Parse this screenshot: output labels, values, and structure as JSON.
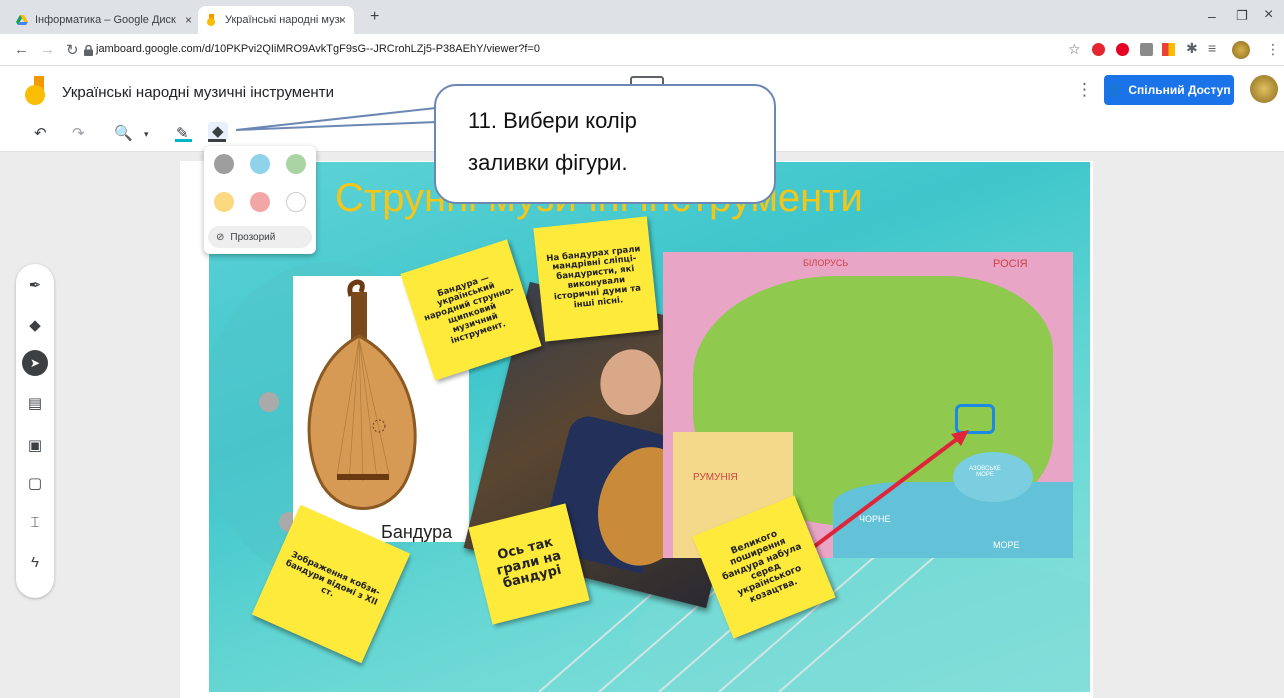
{
  "browser": {
    "tabs": [
      {
        "title": "Інформатика – Google Диск",
        "close": "×"
      },
      {
        "title": "Українські народні музичні інст",
        "close": "×"
      }
    ],
    "new_tab": "+",
    "window_controls": {
      "minimize": "–",
      "restore": "❐",
      "close": "×"
    },
    "url": "jamboard.google.com/d/10PKPvi2QIiMRO9AvkTgF9sG--JRCrohLZj5-P38AEhY/viewer?f=0"
  },
  "app": {
    "title": "Українські народні музичні інструменти",
    "share_label": "Спільний Доступ"
  },
  "palette": {
    "colors": [
      "#9e9e9e",
      "#8ed3ea",
      "#a8d5a2",
      "#fbd981",
      "#f2a7a6",
      "#ffffff"
    ],
    "transparent_label": "Прозорий"
  },
  "callout": {
    "line1": "11. Вибери колір",
    "line2": "заливки фігури."
  },
  "slide": {
    "title": "Струнні музичні інструменти",
    "image_caption": "Бандура",
    "notes": {
      "bandura_def": "Бандура — український народний струнно-щипковий музичний інструмент.",
      "blind": "На бандурах грали мандрівні сліпці-бандуристи, які виконували історичні думи та інші пісні.",
      "kobza": "Зображення кобзи-бандури відомі з XII ст.",
      "played": "Ось так грали на бандурі",
      "cossacks": "Великого поширення бандура набула серед українського козацтва."
    },
    "map_labels": {
      "belarus": "БІЛОРУСЬ",
      "russia": "РОСІЯ",
      "romania": "РУМУНІЯ",
      "azov": "АЗОВСЬКЕ МОРЕ",
      "black_sea_1": "ЧОРНЕ",
      "black_sea_2": "МОРЕ"
    }
  },
  "colors": {
    "share_button": "#1a73e8",
    "callout_border": "#6b87b4",
    "sticky": "#fdea3a",
    "slide_title": "#f5c518"
  }
}
